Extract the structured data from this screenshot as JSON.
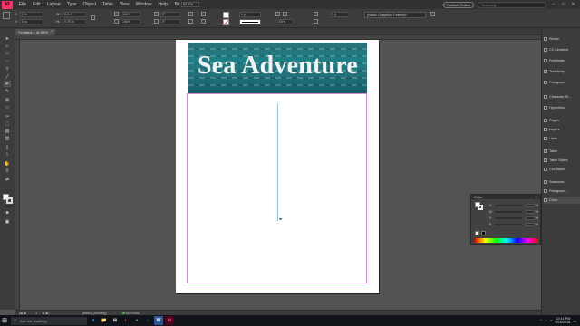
{
  "menubar": {
    "logo": "Id",
    "items": [
      "File",
      "Edit",
      "Layout",
      "Type",
      "Object",
      "Table",
      "View",
      "Window",
      "Help"
    ],
    "zoom": "82.7%",
    "publish_online": "Publish Online",
    "search_placeholder": "Seriously",
    "win_min": "–",
    "win_max": "□",
    "win_close": "✕"
  },
  "control": {
    "x": "0 in",
    "y": "0 in",
    "w": "8.5 in",
    "h": "0.75 in",
    "stroke_weight": "1 pt",
    "tint": "100%",
    "offset": "0 p",
    "style": "[Basic Graphics Frame]+"
  },
  "document": {
    "tab_label": "*Untitled-1 @ 83%",
    "headline": "Sea Adventure"
  },
  "status": {
    "page": "1",
    "master": "[Basic] (working)",
    "errors": "No errors"
  },
  "panels": [
    {
      "label": "Stroke",
      "icon": "stroke-icon"
    },
    {
      "label": "CC Libraries",
      "icon": "cc-libraries-icon"
    },
    {
      "label": "Pathfinder",
      "icon": "pathfinder-icon"
    },
    {
      "label": "Text Wrap",
      "icon": "text-wrap-icon"
    },
    {
      "label": "Paragraph",
      "icon": "paragraph-icon"
    },
    {
      "label": "Character St...",
      "icon": "character-styles-icon"
    },
    {
      "label": "Hyperlinks",
      "icon": "hyperlinks-icon"
    },
    {
      "label": "Pages",
      "icon": "pages-icon"
    },
    {
      "label": "Layers",
      "icon": "layers-icon"
    },
    {
      "label": "Links",
      "icon": "links-icon"
    },
    {
      "label": "Table",
      "icon": "table-icon"
    },
    {
      "label": "Table Styles",
      "icon": "table-styles-icon"
    },
    {
      "label": "Cell Styles",
      "icon": "cell-styles-icon"
    },
    {
      "label": "Swatches",
      "icon": "swatches-icon"
    },
    {
      "label": "Paragraph ...",
      "icon": "paragraph-styles-icon"
    },
    {
      "label": "Color",
      "icon": "color-icon"
    }
  ],
  "color_panel": {
    "title": "Color",
    "channels": [
      "C",
      "M",
      "Y",
      "K"
    ],
    "values": [
      "%",
      "%",
      "%",
      "%"
    ]
  },
  "taskbar": {
    "search_placeholder": "Ask me anything",
    "time": "12:41 PM",
    "date": "6/25/2016",
    "apps": [
      "e",
      "📁",
      "⊞",
      "◐",
      "●",
      "♪",
      "W",
      "Id"
    ]
  },
  "colors": {
    "accent": "#ff3366",
    "margin_guide": "#d38bd3",
    "column_guide": "#8fc3e8"
  }
}
